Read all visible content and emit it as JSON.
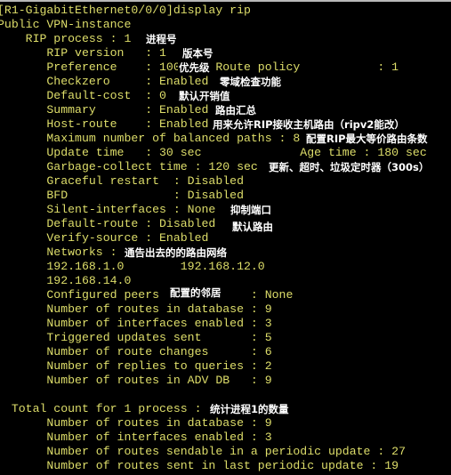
{
  "terminal": {
    "text_color": "#dede6a",
    "background": "#000000",
    "lines": [
      "[R1-GigabitEthernet0/0/0]display rip",
      "Public VPN-instance",
      "    RIP process : 1",
      "       RIP version   : 1",
      "       Preference    : 100     Route policy           : 1",
      "       Checkzero     : Enabled",
      "       Default-cost  : 0",
      "       Summary       : Enabled",
      "       Host-route    : Enabled",
      "       Maximum number of balanced paths : 8",
      "       Update time   : 30 sec              Age time : 180 sec",
      "       Garbage-collect time : 120 sec",
      "       Graceful restart  : Disabled",
      "       BFD               : Disabled",
      "       Silent-interfaces : None",
      "       Default-route : Disabled",
      "       Verify-source : Enabled",
      "       Networks :",
      "       192.168.1.0        192.168.12.0",
      "       192.168.14.0",
      "       Configured peers             : None",
      "       Number of routes in database : 9",
      "       Number of interfaces enabled : 3",
      "       Triggered updates sent       : 5",
      "       Number of route changes      : 6",
      "       Number of replies to queries : 2",
      "       Number of routes in ADV DB   : 9",
      "",
      "  Total count for 1 process :",
      "       Number of routes in database : 9",
      "       Number of interfaces enabled : 3",
      "       Number of routes sendable in a periodic update : 27",
      "       Number of routes sent in last periodic update : 19"
    ]
  },
  "annotations": [
    {
      "line": 2,
      "text": "进程号"
    },
    {
      "line": 3,
      "text": "版本号"
    },
    {
      "line": 4,
      "text": "优先级"
    },
    {
      "line": 5,
      "text": "零域检查功能"
    },
    {
      "line": 6,
      "text": "默认开销值"
    },
    {
      "line": 7,
      "text": "路由汇总"
    },
    {
      "line": 8,
      "text": "用来允许RIP接收主机路由（ripv2能改）"
    },
    {
      "line": 9,
      "text": "配置RIP最大等价路由条数"
    },
    {
      "line": 11,
      "text": "更新、超时、垃圾定时器（300s）"
    },
    {
      "line": 14,
      "text": "抑制端口"
    },
    {
      "line": 15,
      "text": "默认路由"
    },
    {
      "line": 17,
      "text": "通告出去的的路由网络"
    },
    {
      "line": 20,
      "text": "配置的邻居"
    },
    {
      "line": 28,
      "text": "统计进程1的数量"
    }
  ]
}
